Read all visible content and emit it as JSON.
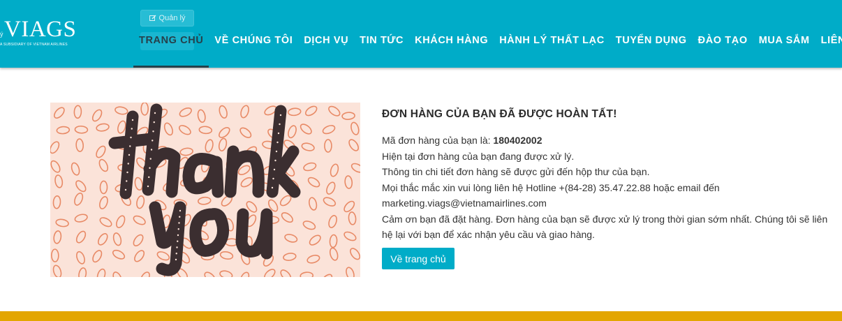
{
  "header": {
    "logo_text": "VIAGS",
    "logo_tagline": "A SUBSIDIARY OF VIETNAM AIRLINES",
    "admin_label": "Quản lý",
    "nav": [
      {
        "label": "TRANG CHỦ",
        "active": true
      },
      {
        "label": "VỀ CHÚNG TÔI",
        "active": false
      },
      {
        "label": "DỊCH VỤ",
        "active": false
      },
      {
        "label": "TIN TỨC",
        "active": false
      },
      {
        "label": "KHÁCH HÀNG",
        "active": false
      },
      {
        "label": "HÀNH LÝ THẤT LẠC",
        "active": false
      },
      {
        "label": "TUYỂN DỤNG",
        "active": false
      },
      {
        "label": "ĐÀO TẠO",
        "active": false
      },
      {
        "label": "MUA SẮM",
        "active": false
      },
      {
        "label": "LIÊN HỆ",
        "active": false
      }
    ]
  },
  "banner": {
    "image_text": "thank you",
    "colors": {
      "background": "#fbe3d9",
      "leaf": "#e88a66",
      "letters": "#3b2e30"
    }
  },
  "order": {
    "title": "ĐƠN HÀNG CỦA BẠN ĐÃ ĐƯỢC HOÀN TẤT!",
    "order_prefix": "Mã đơn hàng của bạn là: ",
    "order_number": "180402002",
    "line_processing": "Hiện tại đơn hàng của bạn đang được xử lý.",
    "line_email": "Thông tin chi tiết đơn hàng sẽ được gửi đến hộp thư của bạn.",
    "line_contact": "Mọi thắc mắc xin vui lòng liên hệ Hotline +(84-28) 35.47.22.88 hoặc email đến marketing.viags@vietnamairlines.com",
    "line_thanks": "Cảm ơn bạn đã đặt hàng. Đơn hàng của bạn sẽ được xử lý trong thời gian sớm nhất. Chúng tôi sẽ liên hệ lại với bạn để xác nhận yêu cầu và giao hàng.",
    "home_button": "Về trang chủ"
  },
  "colors": {
    "header": "#00acc8",
    "active_nav": "#26404a",
    "footer": "#e3a600"
  }
}
